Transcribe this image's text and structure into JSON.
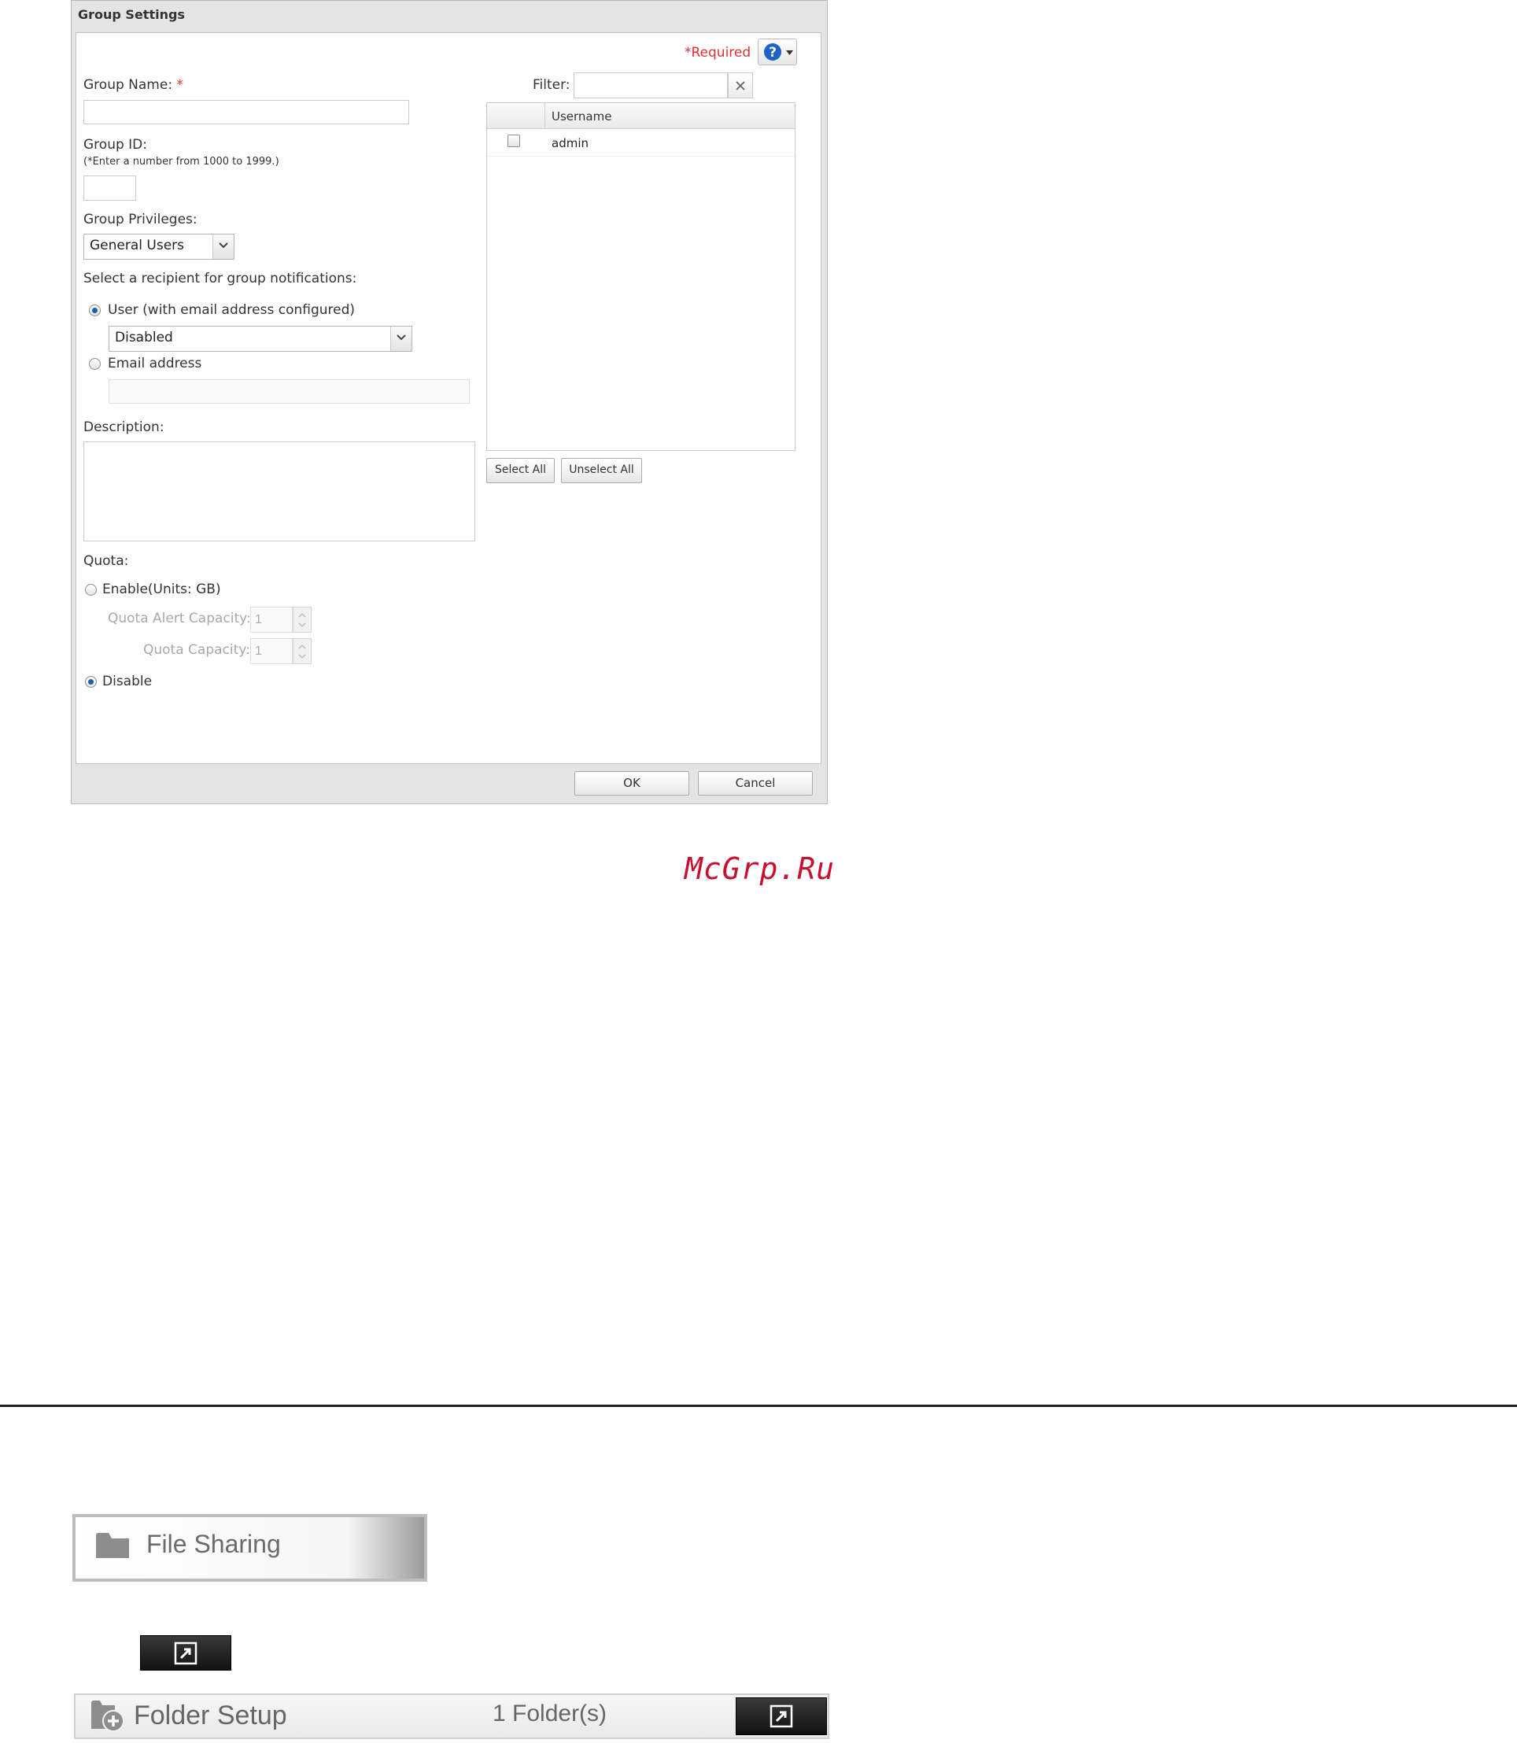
{
  "dialog": {
    "title": "Group Settings",
    "required_label": "*Required",
    "group_name": {
      "label": "Group Name:",
      "required_mark": "*",
      "value": ""
    },
    "group_id": {
      "label": "Group ID:",
      "hint": "(*Enter a number from 1000 to 1999.)",
      "value": ""
    },
    "group_privileges": {
      "label": "Group Privileges:",
      "selected": "General Users"
    },
    "notifications": {
      "label": "Select a recipient for group notifications:",
      "user_option": "User (with email address configured)",
      "user_selected": "Disabled",
      "email_option": "Email address",
      "email_value": "",
      "selected_option": "user"
    },
    "description": {
      "label": "Description:",
      "value": ""
    },
    "quota": {
      "label": "Quota:",
      "enable_option": "Enable(Units: GB)",
      "alert_label": "Quota Alert Capacity:",
      "alert_value": "1",
      "capacity_label": "Quota Capacity:",
      "capacity_value": "1",
      "disable_option": "Disable",
      "selected_option": "disable"
    },
    "filter": {
      "label": "Filter:",
      "value": ""
    },
    "user_table": {
      "header": "Username",
      "rows": [
        {
          "username": "admin",
          "checked": false
        }
      ]
    },
    "select_all_label": "Select All",
    "unselect_all_label": "Unselect All",
    "ok_label": "OK",
    "cancel_label": "Cancel"
  },
  "watermark": "McGrp.Ru",
  "file_sharing": {
    "label": "File Sharing"
  },
  "folder_setup": {
    "label": "Folder Setup",
    "count": "1 Folder(s)"
  },
  "colors": {
    "required": "#e23030",
    "help_icon": "#1e64c8",
    "watermark": "#c8102e"
  },
  "icons": [
    "help-icon",
    "clear-icon",
    "folder-icon",
    "folder-add-icon",
    "open-window-icon"
  ]
}
